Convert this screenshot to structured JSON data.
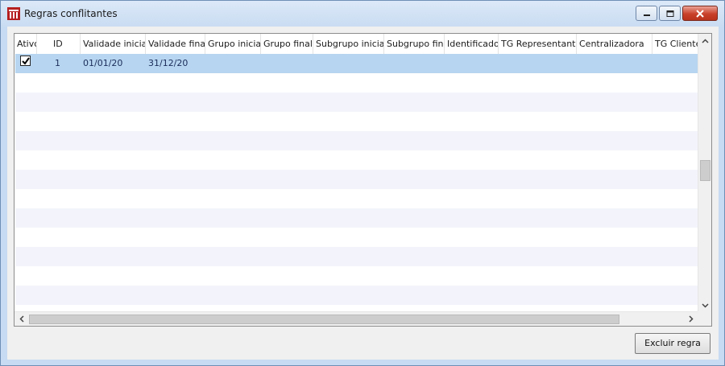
{
  "window": {
    "title": "Regras conflitantes",
    "accent": "#c9402a"
  },
  "grid": {
    "columns": [
      {
        "label": "Ativo"
      },
      {
        "label": "ID"
      },
      {
        "label": "Validade inicial"
      },
      {
        "label": "Validade final"
      },
      {
        "label": "Grupo inicial"
      },
      {
        "label": "Grupo final"
      },
      {
        "label": "Subgrupo inicial"
      },
      {
        "label": "Subgrupo final"
      },
      {
        "label": "Identificador"
      },
      {
        "label": "TG Representante"
      },
      {
        "label": "Centralizadora"
      },
      {
        "label": "TG Cliente"
      }
    ],
    "rows": [
      {
        "ativo": true,
        "id": "1",
        "validade_inicial": "01/01/20",
        "validade_final": "31/12/20",
        "selected": true
      }
    ],
    "selected_color": "#b7d5f0",
    "alt_row_color": "#f3f4fb"
  },
  "actions": {
    "excluir_label": "Excluir regra"
  }
}
